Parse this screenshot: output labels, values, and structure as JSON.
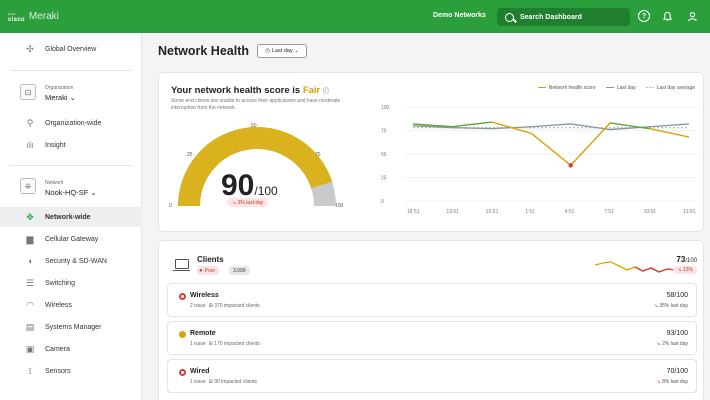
{
  "topbar": {
    "logo_cisco": "cisco",
    "logo_meraki": "Meraki",
    "org_link": "Demo Networks",
    "search_label": "Search Dashboard",
    "help_glyph": "?",
    "bell_glyph": "🔔",
    "user_glyph": "👤"
  },
  "sidebar": {
    "global_overview": "Global Overview",
    "org_small": "Organization",
    "org_name": "Meraki ⌄",
    "org_wide": "Organization-wide",
    "insight": "Insight",
    "network_small": "Network",
    "network_name": "Nook-HQ-SF ⌄",
    "items": [
      {
        "label": "Network-wide",
        "icon": "network-icon"
      },
      {
        "label": "Cellular Gateway",
        "icon": "gateway-icon"
      },
      {
        "label": "Security & SD-WAN",
        "icon": "shield-icon"
      },
      {
        "label": "Switching",
        "icon": "switch-icon"
      },
      {
        "label": "Wireless",
        "icon": "wifi-icon"
      },
      {
        "label": "Systems Manager",
        "icon": "devices-icon"
      },
      {
        "label": "Camera",
        "icon": "camera-icon"
      },
      {
        "label": "Sensors",
        "icon": "sensor-icon"
      }
    ]
  },
  "header": {
    "title": "Network Health",
    "range": "Last day ⌄"
  },
  "health": {
    "title_prefix": "Your network health score is ",
    "status": "Fair",
    "description": "Some end clients are unable to access their applications and have moderate interruption from the network.",
    "score": "90",
    "score_of": "/100",
    "delta": "↘ 3% last day",
    "gauge_labels": {
      "min": "0",
      "q1": "25",
      "mid": "50",
      "q3": "75",
      "max": "100"
    },
    "gauge_value": 90,
    "legend": {
      "score": "Network health score",
      "last_day": "Last day",
      "avg": "Last day average"
    }
  },
  "chart_data": {
    "type": "line",
    "x": [
      "16:51",
      "19:51",
      "22:51",
      "1:51",
      "4:51",
      "7:51",
      "10:51",
      "13:51"
    ],
    "ylim": [
      0,
      100
    ],
    "yticks": [
      "0",
      "25",
      "50",
      "75",
      "100"
    ],
    "series": [
      {
        "name": "Network health score",
        "color": "#5aa832",
        "values": [
          82,
          79,
          84,
          72,
          38,
          83,
          77,
          68
        ]
      },
      {
        "name": "Last day",
        "color": "#8a949c",
        "values": [
          80,
          78,
          77,
          79,
          82,
          76,
          79,
          82
        ]
      },
      {
        "name": "Last day average",
        "color": "#b8c0c6",
        "values": [
          78,
          78,
          78,
          78,
          78,
          78,
          78,
          78
        ]
      }
    ],
    "series_colors_alt": "#d9a400"
  },
  "clients": {
    "title": "Clients",
    "status": "Poor",
    "count": "3,000",
    "score": "73",
    "score_of": "/100",
    "delta": "↘ 13%",
    "rows": [
      {
        "name": "Wireless",
        "issues": "2 issue",
        "impacted": "370 impacted clients",
        "score": "58/100",
        "delta": "35% last day",
        "status": "red"
      },
      {
        "name": "Remote",
        "issues": "1 issue",
        "impacted": "170 impacted clients",
        "score": "93/100",
        "delta": "2% last day",
        "status": "yellow"
      },
      {
        "name": "Wired",
        "issues": "1 issue",
        "impacted": "90 impacted clients",
        "score": "70/100",
        "delta": "8% last day",
        "status": "red"
      }
    ]
  }
}
